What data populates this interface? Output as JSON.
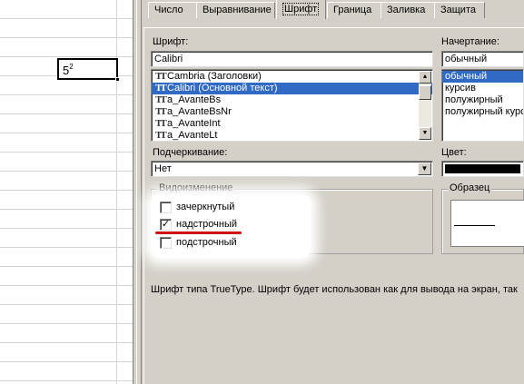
{
  "cell": {
    "base": "5",
    "sup": "2"
  },
  "tabs": [
    {
      "label": "Число"
    },
    {
      "label": "Выравнивание"
    },
    {
      "label": "Шрифт"
    },
    {
      "label": "Граница"
    },
    {
      "label": "Заливка"
    },
    {
      "label": "Защита"
    }
  ],
  "font": {
    "label": "Шрифт:",
    "value": "Calibri",
    "items": [
      {
        "label": "Cambria (Заголовки)"
      },
      {
        "label": "Calibri (Основной текст)"
      },
      {
        "label": "a_AvanteBs"
      },
      {
        "label": "a_AvanteBsNr"
      },
      {
        "label": "a_AvanteInt"
      },
      {
        "label": "a_AvanteLt"
      }
    ],
    "selected_index": 1
  },
  "style": {
    "label": "Начертание:",
    "value": "обычный",
    "items": [
      {
        "label": "обычный"
      },
      {
        "label": "курсив"
      },
      {
        "label": "полужирный"
      },
      {
        "label": "полужирный курсив"
      }
    ]
  },
  "underline": {
    "label": "Подчеркивание:",
    "value": "Нет"
  },
  "color": {
    "label": "Цвет:",
    "swatch": "#000000"
  },
  "effects": {
    "title": "Видоизменение",
    "strike": {
      "label": "зачеркнутый",
      "checked": ""
    },
    "superscript": {
      "label": "надстрочный",
      "checked": "✓"
    },
    "subscript": {
      "label": "подстрочный",
      "checked": ""
    }
  },
  "sample": {
    "title": "Образец"
  },
  "info": "Шрифт типа TrueType. Шрифт будет использован как для вывода на экран, так"
}
